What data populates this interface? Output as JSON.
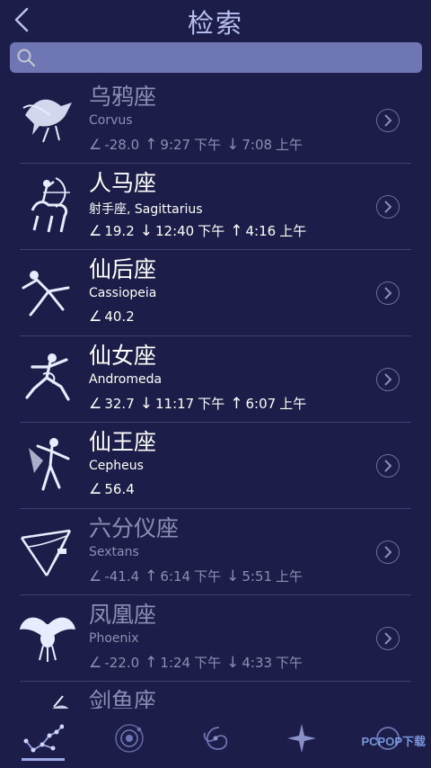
{
  "header": {
    "title": "检索",
    "back_icon": "chevron-left-icon"
  },
  "search": {
    "placeholder": "",
    "value": "",
    "icon": "search-icon"
  },
  "items": [
    {
      "name": "乌鸦座",
      "latin": "Corvus",
      "dim": true,
      "altitude": "-28.0",
      "first_dir": "↑",
      "first_time": "9:27",
      "first_period": "下午",
      "second_dir": "↓",
      "second_time": "7:08",
      "second_period": "上午",
      "art": "crow-constellation-icon"
    },
    {
      "name": "人马座",
      "latin": "射手座, Sagittarius",
      "dim": false,
      "altitude": "19.2",
      "first_dir": "↓",
      "first_time": "12:40",
      "first_period": "下午",
      "second_dir": "↑",
      "second_time": "4:16",
      "second_period": "上午",
      "art": "archer-constellation-icon"
    },
    {
      "name": "仙后座",
      "latin": "Cassiopeia",
      "dim": false,
      "altitude": "40.2",
      "art": "queen-constellation-icon"
    },
    {
      "name": "仙女座",
      "latin": "Andromeda",
      "dim": false,
      "altitude": "32.7",
      "first_dir": "↓",
      "first_time": "11:17",
      "first_period": "下午",
      "second_dir": "↑",
      "second_time": "6:07",
      "second_period": "上午",
      "art": "maiden-constellation-icon"
    },
    {
      "name": "仙王座",
      "latin": "Cepheus",
      "dim": false,
      "altitude": "56.4",
      "art": "king-constellation-icon"
    },
    {
      "name": "六分仪座",
      "latin": "Sextans",
      "dim": true,
      "altitude": "-41.4",
      "first_dir": "↑",
      "first_time": "6:14",
      "first_period": "下午",
      "second_dir": "↓",
      "second_time": "5:51",
      "second_period": "上午",
      "art": "sextant-constellation-icon"
    },
    {
      "name": "凤凰座",
      "latin": "Phoenix",
      "dim": true,
      "altitude": "-22.0",
      "first_dir": "↑",
      "first_time": "1:24",
      "first_period": "下午",
      "second_dir": "↓",
      "second_time": "4:33",
      "second_period": "下午",
      "art": "phoenix-constellation-icon"
    },
    {
      "name": "剑鱼座",
      "latin": "",
      "dim": true,
      "altitude": "",
      "art": "swordfish-constellation-icon"
    }
  ],
  "tabs": [
    {
      "name": "constellations-tab",
      "icon": "constellation-icon",
      "active": true
    },
    {
      "name": "solar-system-tab",
      "icon": "planet-icon",
      "active": false
    },
    {
      "name": "deep-sky-tab",
      "icon": "galaxy-icon",
      "active": false
    },
    {
      "name": "stars-tab",
      "icon": "star-icon",
      "active": false
    },
    {
      "name": "other-tab",
      "icon": "other-icon",
      "active": false
    }
  ],
  "watermark": "PCPOP下载",
  "colors": {
    "background": "#1c1d48",
    "title": "#b7c0f0",
    "search_bg": "#8a94d8",
    "dim_text": "#8b8fb3",
    "accent": "#9aa8e8"
  }
}
